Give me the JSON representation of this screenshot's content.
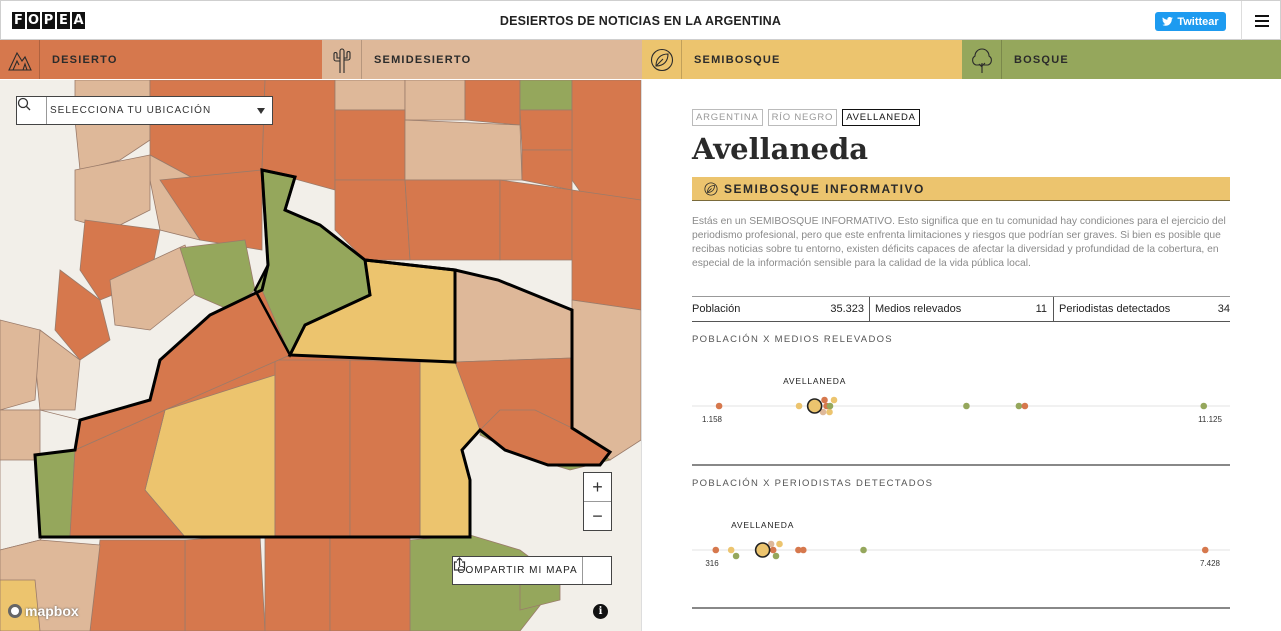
{
  "header": {
    "logo_letters": [
      "F",
      "O",
      "P",
      "E",
      "A"
    ],
    "title": "DESIERTOS DE NOTICIAS EN LA ARGENTINA",
    "twitter_label": "Twittear"
  },
  "categories": [
    {
      "label": "DESIERTO",
      "icon": "mountain-icon",
      "color": "#d6784d"
    },
    {
      "label": "SEMIDESIERTO",
      "icon": "cactus-icon",
      "color": "#deb899"
    },
    {
      "label": "SEMIBOSQUE",
      "icon": "leaf-icon",
      "color": "#ecc46e"
    },
    {
      "label": "BOSQUE",
      "icon": "tree-icon",
      "color": "#95a75c"
    }
  ],
  "map": {
    "search_placeholder": "SELECCIONA TU UBICACIÓN",
    "zoom_in": "+",
    "zoom_out": "−",
    "share_label": "COMPARTIR MI MAPA",
    "attribution": "mapbox",
    "info": "i"
  },
  "detail": {
    "breadcrumb": [
      "ARGENTINA",
      "RÍO NEGRO",
      "AVELLANEDA"
    ],
    "place_name": "Avellaneda",
    "category_label": "SEMIBOSQUE INFORMATIVO",
    "description": "Estás en un SEMIBOSQUE INFORMATIVO. Esto significa que en tu comunidad hay condiciones para el ejercicio del periodismo profesional, pero que este enfrenta limitaciones y riesgos que podrían ser graves. Si bien es posible que recibas noticias sobre tu entorno, existen déficits capaces de afectar la diversidad y profundidad de la cobertura, en especial de la información sensible para la calidad de la vida pública local.",
    "stats": [
      {
        "label": "Población",
        "value": "35.323"
      },
      {
        "label": "Medios relevados",
        "value": "11"
      },
      {
        "label": "Periodistas detectados",
        "value": "34"
      }
    ],
    "plot1": {
      "title": "POBLACIÓN X MEDIOS RELEVADOS",
      "highlight_label": "AVELLANEDA",
      "min_label": "1.158",
      "max_label": "11.125",
      "min": 1158,
      "max": 11125,
      "highlight": {
        "value": 3212,
        "category": "semibosque"
      },
      "points": [
        {
          "value": 1300,
          "category": "desierto"
        },
        {
          "value": 2900,
          "category": "semibosque"
        },
        {
          "value": 3380,
          "category": "semidesierto"
        },
        {
          "value": 3410,
          "category": "desierto"
        },
        {
          "value": 3450,
          "category": "desierto"
        },
        {
          "value": 3510,
          "category": "semibosque"
        },
        {
          "value": 3600,
          "category": "semibosque"
        },
        {
          "value": 3520,
          "category": "bosque"
        },
        {
          "value": 6250,
          "category": "bosque"
        },
        {
          "value": 7300,
          "category": "bosque"
        },
        {
          "value": 7420,
          "category": "desierto"
        },
        {
          "value": 11000,
          "category": "bosque"
        }
      ]
    },
    "plot2": {
      "title": "POBLACIÓN X PERIODISTAS DETECTADOS",
      "highlight_label": "AVELLANEDA",
      "min_label": "316",
      "max_label": "7.428",
      "min": 316,
      "max": 7428,
      "highlight": {
        "value": 1039,
        "category": "semibosque"
      },
      "points": [
        {
          "value": 370,
          "category": "desierto"
        },
        {
          "value": 590,
          "category": "semibosque"
        },
        {
          "value": 660,
          "category": "bosque"
        },
        {
          "value": 1160,
          "category": "semidesierto"
        },
        {
          "value": 1190,
          "category": "desierto"
        },
        {
          "value": 1230,
          "category": "bosque"
        },
        {
          "value": 1280,
          "category": "semibosque"
        },
        {
          "value": 1550,
          "category": "desierto"
        },
        {
          "value": 1620,
          "category": "desierto"
        },
        {
          "value": 2480,
          "category": "bosque"
        },
        {
          "value": 7360,
          "category": "desierto"
        }
      ]
    },
    "colors": {
      "desierto": "#d6784d",
      "semidesierto": "#deb899",
      "semibosque": "#ecc46e",
      "bosque": "#95a75c"
    }
  }
}
